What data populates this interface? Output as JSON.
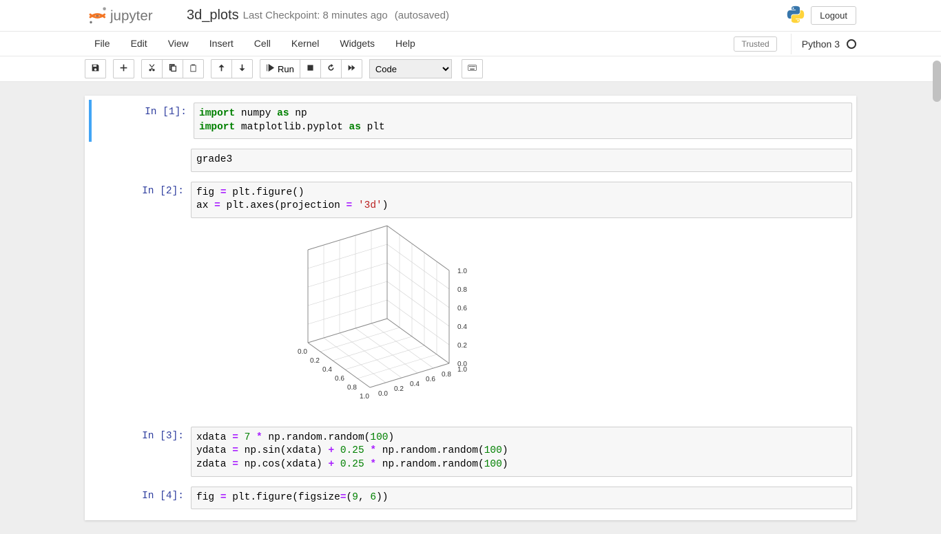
{
  "header": {
    "notebook_name": "3d_plots",
    "checkpoint": "Last Checkpoint: 8 minutes ago",
    "autosaved": "(autosaved)",
    "logout": "Logout"
  },
  "menu": {
    "file": "File",
    "edit": "Edit",
    "view": "View",
    "insert": "Insert",
    "cell": "Cell",
    "kernel": "Kernel",
    "widgets": "Widgets",
    "help": "Help",
    "trusted": "Trusted",
    "kernel_name": "Python 3"
  },
  "toolbar": {
    "run_label": "Run",
    "cell_type": "Code"
  },
  "cells": {
    "c1_prompt": "In [1]:",
    "c2_prompt": "In [2]:",
    "c3_prompt": "In [3]:",
    "c4_prompt": "In [4]:",
    "c1a": "import",
    "c1b": " numpy ",
    "c1c": "as",
    "c1d": " np\n",
    "c1e": "import",
    "c1f": " matplotlib.pyplot ",
    "c1g": "as",
    "c1h": " plt",
    "out1": "grade3",
    "c2a": "fig ",
    "c2b": "=",
    "c2c": " plt.figure()\nax ",
    "c2d": "=",
    "c2e": " plt.axes(projection ",
    "c2f": "=",
    "c2g": " ",
    "c2h": "'3d'",
    "c2i": ")",
    "c3a": "xdata ",
    "c3b": "=",
    "c3c": " ",
    "c3d": "7",
    "c3e": " ",
    "c3f": "*",
    "c3g": " np.random.random(",
    "c3h": "100",
    "c3i": ")\nydata ",
    "c3j": "=",
    "c3k": " np.sin(xdata) ",
    "c3l": "+",
    "c3m": " ",
    "c3n": "0.25",
    "c3o": " ",
    "c3p": "*",
    "c3q": " np.random.random(",
    "c3r": "100",
    "c3s": ")\nzdata ",
    "c3t": "=",
    "c3u": " np.cos(xdata) ",
    "c3v": "+",
    "c3w": " ",
    "c3x": "0.25",
    "c3y": " ",
    "c3z": "*",
    "c3aa": " np.random.random(",
    "c3ab": "100",
    "c3ac": ")",
    "c4a": "fig ",
    "c4b": "=",
    "c4c": " plt.figure(figsize",
    "c4d": "=",
    "c4e": "(",
    "c4f": "9",
    "c4g": ", ",
    "c4h": "6",
    "c4i": "))"
  },
  "chart_data": {
    "type": "3d-axes-empty",
    "title": "",
    "x_ticks": [
      0.0,
      0.2,
      0.4,
      0.6,
      0.8,
      1.0
    ],
    "y_ticks": [
      0.0,
      0.2,
      0.4,
      0.6,
      0.8,
      1.0
    ],
    "z_ticks": [
      0.0,
      0.2,
      0.4,
      0.6,
      0.8,
      1.0
    ],
    "xlim": [
      0.0,
      1.0
    ],
    "ylim": [
      0.0,
      1.0
    ],
    "zlim": [
      0.0,
      1.0
    ],
    "series": []
  }
}
